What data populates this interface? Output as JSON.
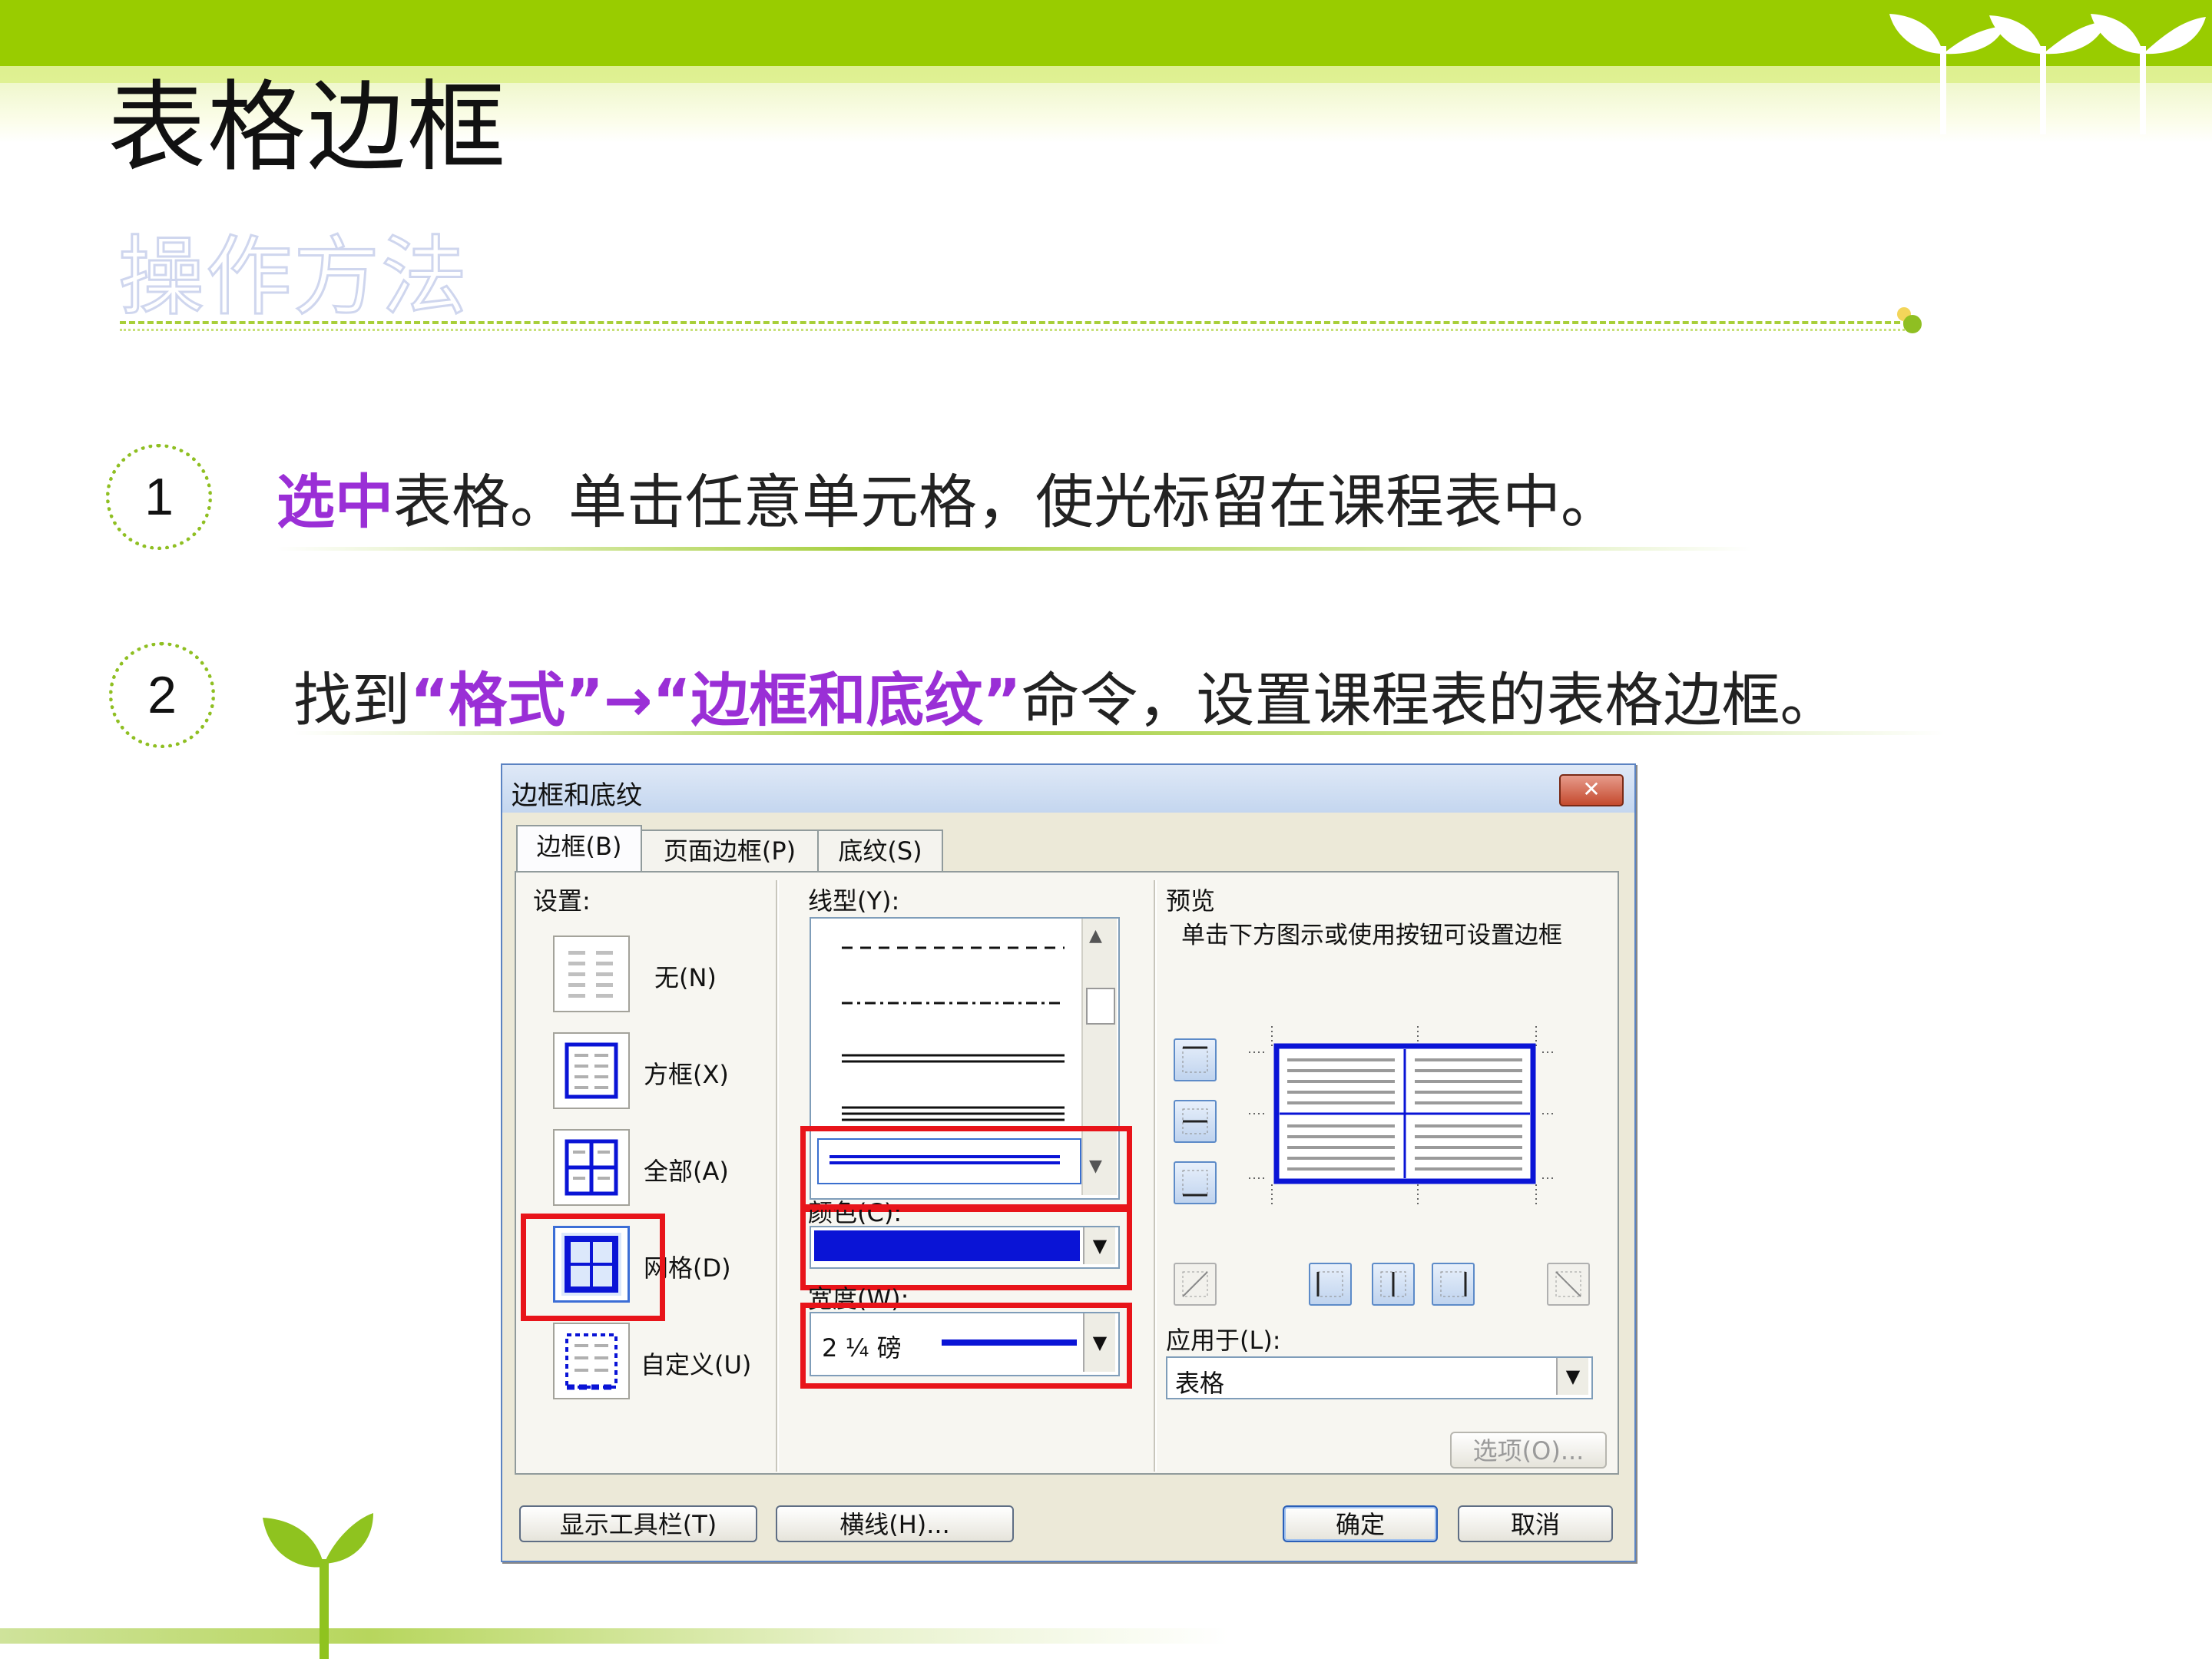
{
  "slide": {
    "title": "表格边框",
    "subtitle": "操作方法",
    "steps": [
      {
        "number": "1",
        "highlight": "选中",
        "text": "表格。单击任意单元格，使光标留在课程表中。"
      },
      {
        "number": "2",
        "prefix": "找到",
        "highlight1": "“格式”→“边框和底纹”",
        "text": "命令，设置课程表的表格边框。"
      }
    ],
    "colors": {
      "accent_green": "#99cc00",
      "highlight_purple": "#9a2fd6",
      "annotation_red": "#e8141a",
      "border_blue": "#0a14d6"
    }
  },
  "dialog": {
    "title": "边框和底纹",
    "close_label": "✕",
    "tabs": [
      {
        "label": "边框(B)",
        "active": true
      },
      {
        "label": "页面边框(P)",
        "active": false
      },
      {
        "label": "底纹(S)",
        "active": false
      }
    ],
    "settings": {
      "label": "设置:",
      "items": [
        {
          "label": "无(N)",
          "icon": "none-border-icon"
        },
        {
          "label": "方框(X)",
          "icon": "box-border-icon"
        },
        {
          "label": "全部(A)",
          "icon": "all-border-icon"
        },
        {
          "label": "网格(D)",
          "icon": "grid-border-icon",
          "selected": true
        },
        {
          "label": "自定义(U)",
          "icon": "custom-border-icon"
        }
      ]
    },
    "line_style": {
      "label": "线型(Y):",
      "selected": "double"
    },
    "color": {
      "label": "颜色(C):",
      "value": "#0a14d6"
    },
    "width": {
      "label": "宽度(W):",
      "value": "2 ¼ 磅"
    },
    "preview": {
      "label": "预览",
      "hint": "单击下方图示或使用按钮可设置边框"
    },
    "apply_to": {
      "label": "应用于(L):",
      "value": "表格"
    },
    "options_button": "选项(O)...",
    "buttons": {
      "show_toolbar": "显示工具栏(T)",
      "horizontal_line": "横线(H)...",
      "ok": "确定",
      "cancel": "取消"
    }
  }
}
